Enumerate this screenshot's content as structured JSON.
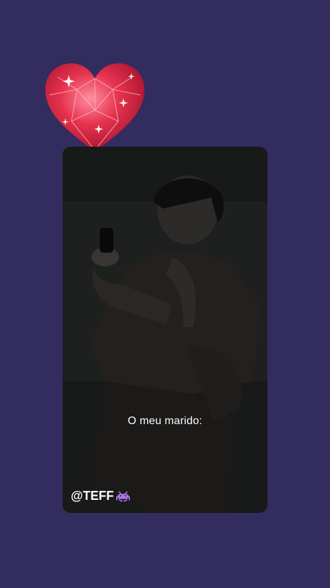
{
  "colors": {
    "background": "#332c5f",
    "heart": "#e0324f",
    "caption_text": "#ffffff"
  },
  "overlay": {
    "caption": "O meu marido:",
    "watermark": "@TEFF",
    "watermark_icon": "alien-monster-icon"
  }
}
